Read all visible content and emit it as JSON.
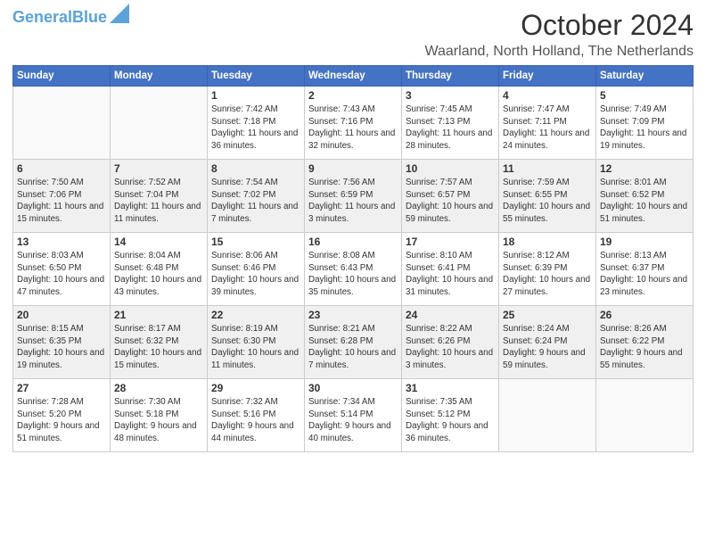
{
  "logo": {
    "line1": "General",
    "line2": "Blue"
  },
  "header": {
    "month": "October 2024",
    "location": "Waarland, North Holland, The Netherlands"
  },
  "weekdays": [
    "Sunday",
    "Monday",
    "Tuesday",
    "Wednesday",
    "Thursday",
    "Friday",
    "Saturday"
  ],
  "weeks": [
    [
      {
        "day": "",
        "info": ""
      },
      {
        "day": "",
        "info": ""
      },
      {
        "day": "1",
        "info": "Sunrise: 7:42 AM\nSunset: 7:18 PM\nDaylight: 11 hours and 36 minutes."
      },
      {
        "day": "2",
        "info": "Sunrise: 7:43 AM\nSunset: 7:16 PM\nDaylight: 11 hours and 32 minutes."
      },
      {
        "day": "3",
        "info": "Sunrise: 7:45 AM\nSunset: 7:13 PM\nDaylight: 11 hours and 28 minutes."
      },
      {
        "day": "4",
        "info": "Sunrise: 7:47 AM\nSunset: 7:11 PM\nDaylight: 11 hours and 24 minutes."
      },
      {
        "day": "5",
        "info": "Sunrise: 7:49 AM\nSunset: 7:09 PM\nDaylight: 11 hours and 19 minutes."
      }
    ],
    [
      {
        "day": "6",
        "info": "Sunrise: 7:50 AM\nSunset: 7:06 PM\nDaylight: 11 hours and 15 minutes."
      },
      {
        "day": "7",
        "info": "Sunrise: 7:52 AM\nSunset: 7:04 PM\nDaylight: 11 hours and 11 minutes."
      },
      {
        "day": "8",
        "info": "Sunrise: 7:54 AM\nSunset: 7:02 PM\nDaylight: 11 hours and 7 minutes."
      },
      {
        "day": "9",
        "info": "Sunrise: 7:56 AM\nSunset: 6:59 PM\nDaylight: 11 hours and 3 minutes."
      },
      {
        "day": "10",
        "info": "Sunrise: 7:57 AM\nSunset: 6:57 PM\nDaylight: 10 hours and 59 minutes."
      },
      {
        "day": "11",
        "info": "Sunrise: 7:59 AM\nSunset: 6:55 PM\nDaylight: 10 hours and 55 minutes."
      },
      {
        "day": "12",
        "info": "Sunrise: 8:01 AM\nSunset: 6:52 PM\nDaylight: 10 hours and 51 minutes."
      }
    ],
    [
      {
        "day": "13",
        "info": "Sunrise: 8:03 AM\nSunset: 6:50 PM\nDaylight: 10 hours and 47 minutes."
      },
      {
        "day": "14",
        "info": "Sunrise: 8:04 AM\nSunset: 6:48 PM\nDaylight: 10 hours and 43 minutes."
      },
      {
        "day": "15",
        "info": "Sunrise: 8:06 AM\nSunset: 6:46 PM\nDaylight: 10 hours and 39 minutes."
      },
      {
        "day": "16",
        "info": "Sunrise: 8:08 AM\nSunset: 6:43 PM\nDaylight: 10 hours and 35 minutes."
      },
      {
        "day": "17",
        "info": "Sunrise: 8:10 AM\nSunset: 6:41 PM\nDaylight: 10 hours and 31 minutes."
      },
      {
        "day": "18",
        "info": "Sunrise: 8:12 AM\nSunset: 6:39 PM\nDaylight: 10 hours and 27 minutes."
      },
      {
        "day": "19",
        "info": "Sunrise: 8:13 AM\nSunset: 6:37 PM\nDaylight: 10 hours and 23 minutes."
      }
    ],
    [
      {
        "day": "20",
        "info": "Sunrise: 8:15 AM\nSunset: 6:35 PM\nDaylight: 10 hours and 19 minutes."
      },
      {
        "day": "21",
        "info": "Sunrise: 8:17 AM\nSunset: 6:32 PM\nDaylight: 10 hours and 15 minutes."
      },
      {
        "day": "22",
        "info": "Sunrise: 8:19 AM\nSunset: 6:30 PM\nDaylight: 10 hours and 11 minutes."
      },
      {
        "day": "23",
        "info": "Sunrise: 8:21 AM\nSunset: 6:28 PM\nDaylight: 10 hours and 7 minutes."
      },
      {
        "day": "24",
        "info": "Sunrise: 8:22 AM\nSunset: 6:26 PM\nDaylight: 10 hours and 3 minutes."
      },
      {
        "day": "25",
        "info": "Sunrise: 8:24 AM\nSunset: 6:24 PM\nDaylight: 9 hours and 59 minutes."
      },
      {
        "day": "26",
        "info": "Sunrise: 8:26 AM\nSunset: 6:22 PM\nDaylight: 9 hours and 55 minutes."
      }
    ],
    [
      {
        "day": "27",
        "info": "Sunrise: 7:28 AM\nSunset: 5:20 PM\nDaylight: 9 hours and 51 minutes."
      },
      {
        "day": "28",
        "info": "Sunrise: 7:30 AM\nSunset: 5:18 PM\nDaylight: 9 hours and 48 minutes."
      },
      {
        "day": "29",
        "info": "Sunrise: 7:32 AM\nSunset: 5:16 PM\nDaylight: 9 hours and 44 minutes."
      },
      {
        "day": "30",
        "info": "Sunrise: 7:34 AM\nSunset: 5:14 PM\nDaylight: 9 hours and 40 minutes."
      },
      {
        "day": "31",
        "info": "Sunrise: 7:35 AM\nSunset: 5:12 PM\nDaylight: 9 hours and 36 minutes."
      },
      {
        "day": "",
        "info": ""
      },
      {
        "day": "",
        "info": ""
      }
    ]
  ]
}
